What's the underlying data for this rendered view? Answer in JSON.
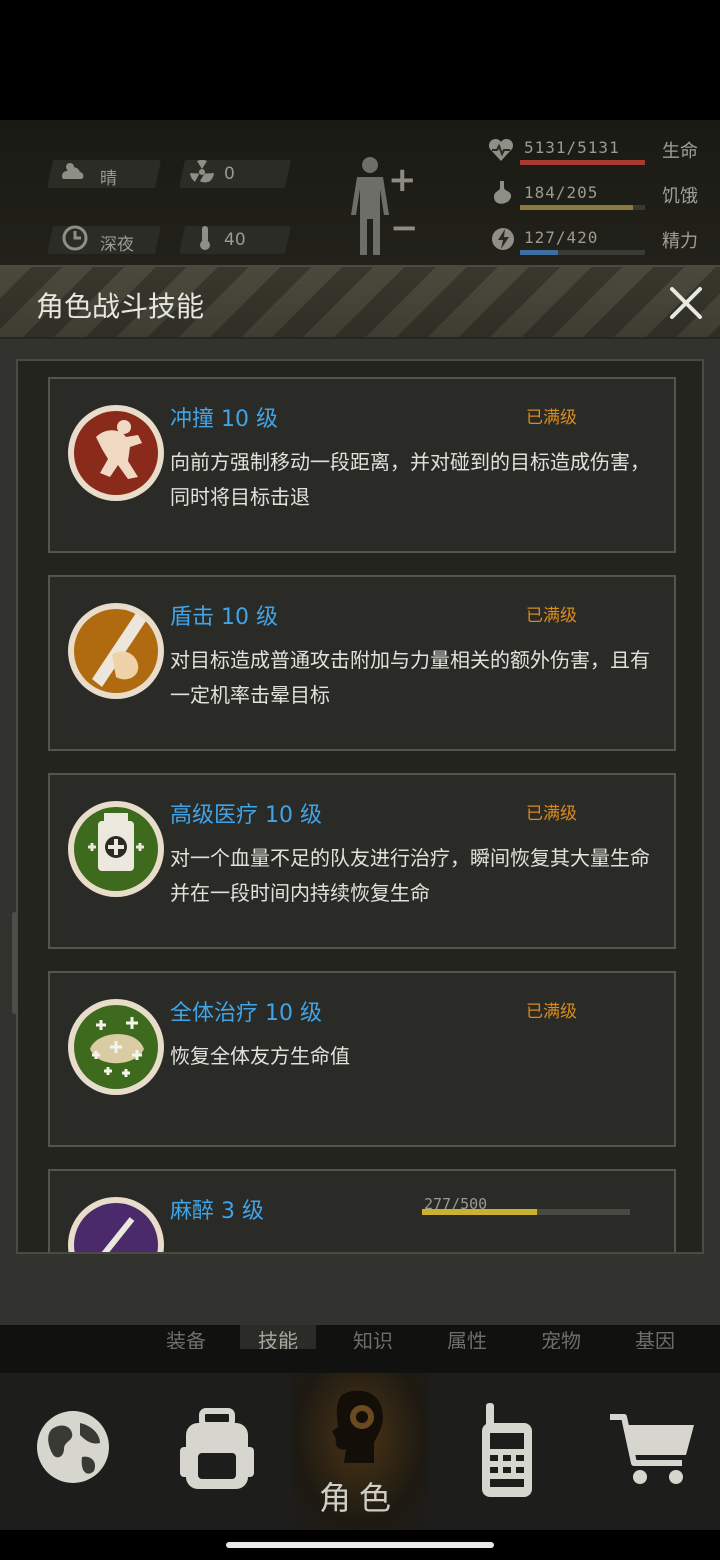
{
  "hud": {
    "weather": "晴",
    "radiation": "0",
    "time_of_day": "深夜",
    "temperature": "40",
    "life": {
      "value": "5131/5131",
      "label": "生命",
      "fill": 1.0,
      "color": "#a83a32"
    },
    "hunger": {
      "value": "184/205",
      "label": "饥饿",
      "fill": 0.9,
      "color": "#8c7a3a"
    },
    "energy": {
      "value": "127/420",
      "label": "精力",
      "fill": 0.3,
      "color": "#3a6fa0"
    },
    "body_plus": "+",
    "body_minus": "−"
  },
  "dialog": {
    "title": "角色战斗技能",
    "close_icon": "close-icon",
    "skills": [
      {
        "name": "冲撞 10 级",
        "status": "已满级",
        "desc": "向前方强制移动一段距离，并对碰到的目标造成伤害，同时将目标击退",
        "icon": "charge-icon",
        "icon_color": "#8a2a1a"
      },
      {
        "name": "盾击 10 级",
        "status": "已满级",
        "desc": "对目标造成普通攻击附加与力量相关的额外伤害，且有一定机率击晕目标",
        "icon": "shield-bash-icon",
        "icon_color": "#b06a10"
      },
      {
        "name": "高级医疗 10 级",
        "status": "已满级",
        "desc": "对一个血量不足的队友进行治疗，瞬间恢复其大量生命并在一段时间内持续恢复生命",
        "icon": "advanced-medical-icon",
        "icon_color": "#3e6a1e"
      },
      {
        "name": "全体治疗 10 级",
        "status": "已满级",
        "desc": "恢复全体友方生命值",
        "icon": "group-heal-icon",
        "icon_color": "#3e6a1e"
      },
      {
        "name": "麻醉 3 级",
        "progress_text": "277/500",
        "progress": 0.554,
        "desc": "",
        "icon": "anesthesia-icon",
        "icon_color": "#4a2a6a"
      }
    ]
  },
  "subtabs": [
    "装备",
    "技能",
    "知识",
    "属性",
    "宠物",
    "基因"
  ],
  "subtab_active": 1,
  "nav": {
    "items": [
      "globe-icon",
      "backpack-icon",
      "character-icon",
      "walkie-talkie-icon",
      "cart-icon"
    ],
    "active_label": "角色"
  }
}
